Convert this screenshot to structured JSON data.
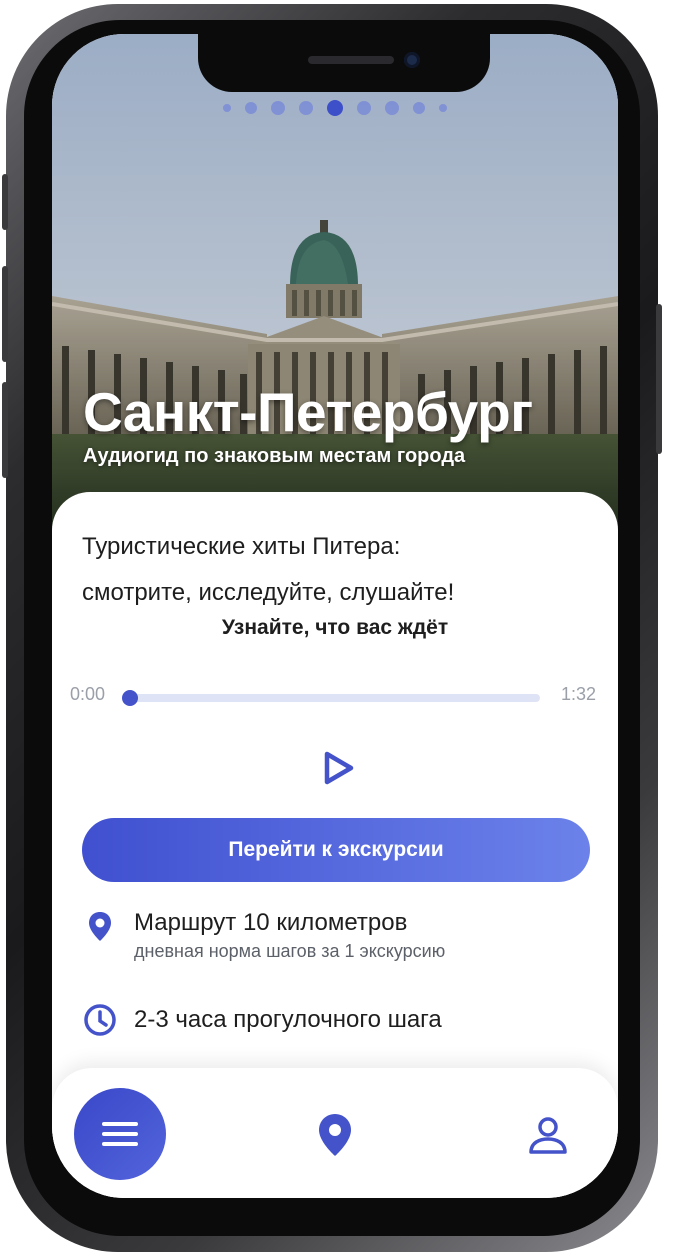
{
  "hero": {
    "title": "Санкт-Петербург",
    "subtitle": "Аудиогид по знаковым местам города",
    "carousel": {
      "count": 9,
      "active_index": 4
    }
  },
  "card": {
    "description_line1": "Туристические хиты Питера:",
    "description_line2": "смотрите, исследуйте, слушайте!",
    "preview_label": "Узнайте, что вас ждёт"
  },
  "player": {
    "current_time": "0:00",
    "total_time": "1:32",
    "progress": 0.0
  },
  "cta": {
    "label": "Перейти к экскурсии"
  },
  "route": {
    "title": "Маршрут 10 километров",
    "subtitle": "дневная норма шагов за 1 экскурсию"
  },
  "duration": {
    "title": "2-3 часа прогулочного шага"
  },
  "nav": {
    "items": [
      "menu-icon",
      "location-pin-icon",
      "profile-icon"
    ]
  },
  "colors": {
    "accent": "#4453c9",
    "accent_light": "#6c82ea",
    "text": "#1e1e1e"
  }
}
